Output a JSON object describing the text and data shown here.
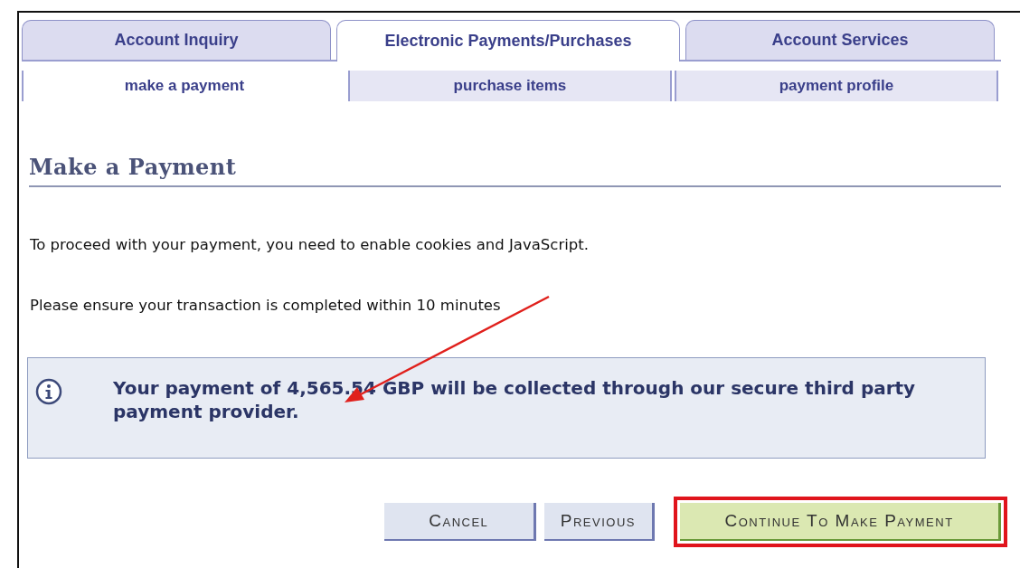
{
  "tabs": [
    {
      "label": "Account Inquiry",
      "selected": false
    },
    {
      "label": "Electronic Payments/Purchases",
      "selected": true
    },
    {
      "label": "Account Services",
      "selected": false
    }
  ],
  "subtabs": [
    {
      "label": "make a payment",
      "selected": true
    },
    {
      "label": "purchase items",
      "selected": false
    },
    {
      "label": "payment profile",
      "selected": false
    }
  ],
  "page_title": "Make a Payment",
  "paragraphs": [
    "To proceed with your payment, you need to enable cookies and JavaScript.",
    "Please ensure your transaction is completed within 10 minutes"
  ],
  "info_message": "Your payment of 4,565.54 GBP will be collected through our secure third party payment provider.",
  "buttons": [
    {
      "label": "Cancel",
      "kind": "normal"
    },
    {
      "label": "Previous",
      "kind": "normal"
    },
    {
      "label": "Continue To Make Payment",
      "kind": "primary"
    }
  ]
}
